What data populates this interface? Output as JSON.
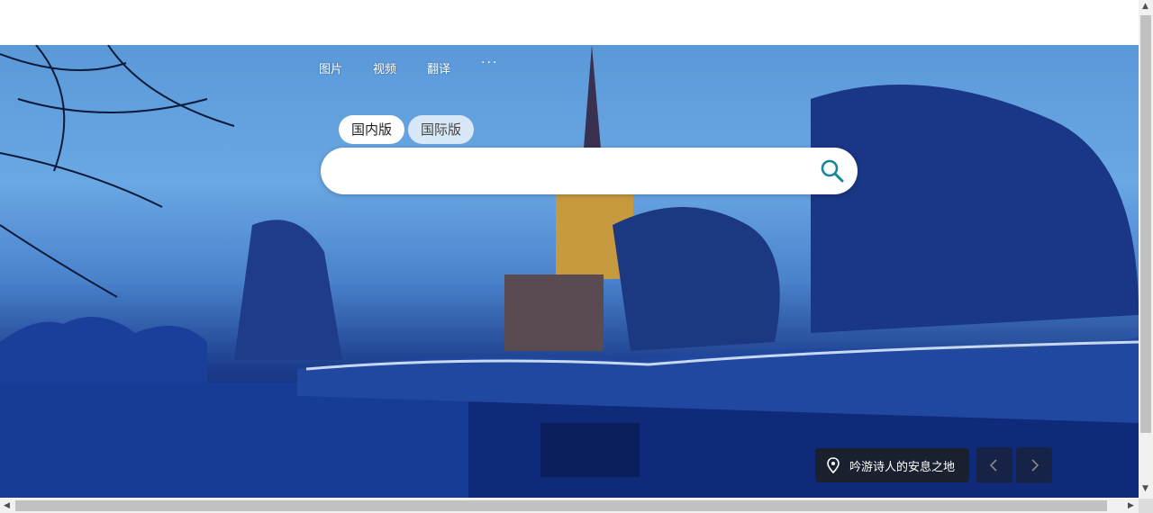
{
  "nav": {
    "items": [
      "图片",
      "视频",
      "翻译"
    ],
    "more": "···"
  },
  "tabs": [
    {
      "label": "国内版",
      "active": true
    },
    {
      "label": "国际版",
      "active": false
    }
  ],
  "search": {
    "placeholder": "",
    "value": ""
  },
  "location": {
    "label": "吟游诗人的安息之地",
    "icon": "map-pin-icon"
  },
  "controls": {
    "prev_icon": "chevron-left-icon",
    "next_icon": "chevron-right-icon"
  },
  "colors": {
    "search_icon": "#17869a",
    "location_bg": "#1e1e1e"
  }
}
